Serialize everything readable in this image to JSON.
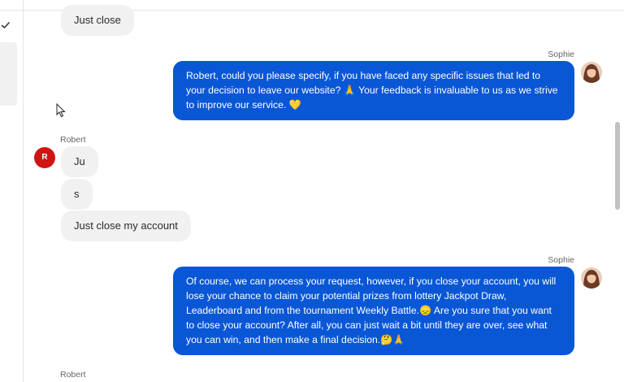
{
  "messages": [
    {
      "sender": "",
      "text": "Just close"
    },
    {
      "sender": "Sophie",
      "text": "Robert, could you please specify, if you have faced any specific issues that led to your decision to leave our website? 🙏 Your feedback is invaluable to us as we strive to improve our service. 💛"
    },
    {
      "sender": "Robert",
      "avatar_initial": "R",
      "bubbles": [
        "Ju",
        "s",
        "Just close my account"
      ]
    },
    {
      "sender": "Sophie",
      "text": "Of course, we can process your request, however, if you close your account, you will lose your chance to claim your potential prizes from lottery Jackpot Draw, Leaderboard and from the tournament Weekly Battle.😞 Are you sure that you want to close your account? After all, you can just wait a bit until they are over, see what you can win, and then make a final decision.🤔🙏"
    },
    {
      "sender": "Robert"
    }
  ],
  "colors": {
    "outgoing_bubble": "#0a57d6",
    "incoming_bubble": "#f1f1f1",
    "robert_avatar": "#cf1414"
  },
  "icons": [
    "checkmark-icon",
    "mouse-cursor-icon"
  ]
}
